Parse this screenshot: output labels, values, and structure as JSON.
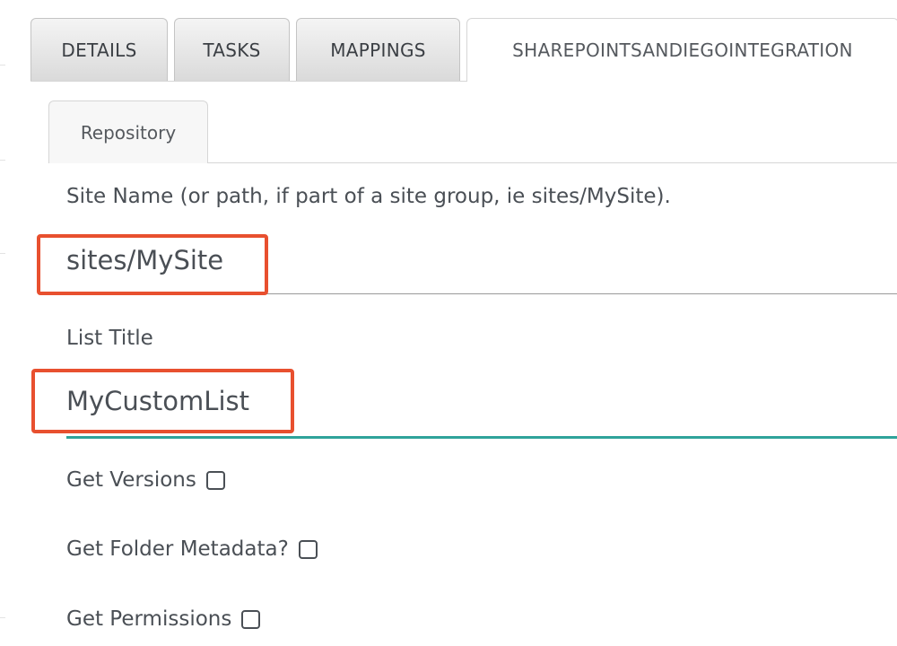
{
  "tabs": {
    "details": "DETAILS",
    "tasks": "TASKS",
    "mappings": "MAPPINGS",
    "integration": "SHAREPOINTSANDIEGOINTEGRATION"
  },
  "subtabs": {
    "repository": "Repository"
  },
  "form": {
    "site_name_label": "Site Name (or path, if part of a site group, ie sites/MySite).",
    "site_name_value": "sites/MySite",
    "list_title_label": "List Title",
    "list_title_value": "MyCustomList",
    "get_versions_label": "Get Versions",
    "get_versions_checked": false,
    "get_folder_metadata_label": "Get Folder Metadata?",
    "get_folder_metadata_checked": false,
    "get_permissions_label": "Get Permissions",
    "get_permissions_checked": false
  },
  "colors": {
    "highlight": "#e8502f",
    "active_underline": "#2fa39a",
    "inactive_underline": "#9a9a9a"
  }
}
